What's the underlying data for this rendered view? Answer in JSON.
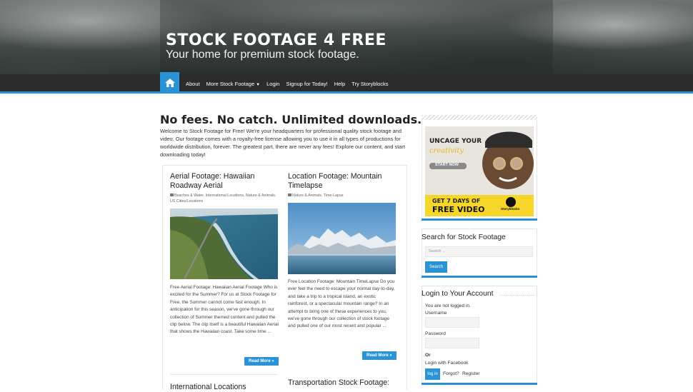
{
  "header": {
    "site_title": "STOCK FOOTAGE 4 FREE",
    "tagline": "Your home for premium stock footage."
  },
  "nav": {
    "home_icon": "home-icon",
    "items": [
      "About",
      "More Stock Footage",
      "Login",
      "Signup for Today!",
      "Help",
      "Try Storyblocks"
    ]
  },
  "intro": {
    "title": "No fees. No catch. Unlimited downloads.",
    "text": "Welcome to Stock Footage for Free! We're your headquarters for professional quality stock footage and video. Our footage comes with a royalty-free license allowing you to use it in all types of productions for worldwide distribution, forever. The greatest part, there are never any fees! Explore our content, and start downloading today!"
  },
  "posts": [
    {
      "title": "Aerial Footage: Hawaiian Roadway Aerial",
      "meta": "Beaches & Water, International Locations, Nature & Animals, US Cities/Locations",
      "excerpt": "Free Aerial Footage: Hawaiian Aerial Footage Who is excited for the Summer? For us at Stock Footage for Free, the Summer cannot come fast enough. In anticipation for this season, we've gone through our collection of Summer themed content and pulled the clip below. The clip itself is a beautiful Hawaiian Aerial that shows the Hawaiian coast. Take some time ...",
      "read_more": "Read More »"
    },
    {
      "title": "Location Footage: Mountain Timelapse",
      "meta": "Nature & Animals, Time-Lapse",
      "excerpt": "Free Location Footage: Mountain TimeLapse Do you ever feel the need to escape your normal day-to-day, and take a trip to a tropical island, an exotic rainforest, or a spectacular mountain range? In an attempt to bring one of these experiences to you, we've gone through our collection of stock footage and pulled one of our most recent and popular ...",
      "read_more": "Read More »"
    },
    {
      "title": "International Locations"
    },
    {
      "title": "Transportation Stock Footage:"
    }
  ],
  "sidebar": {
    "ad": {
      "headline": "UNCAGE YOUR",
      "script": "creativity",
      "cta": "START NOW",
      "offer_line1": "GET 7 DAYS OF",
      "offer_line2": "FREE VIDEO",
      "brand": "Storyblocks"
    },
    "search": {
      "title": "Search for Stock Footage",
      "placeholder": "Search ...",
      "button": "Search"
    },
    "login": {
      "title": "Login to Your Account",
      "status": "You are not logged in.",
      "username_label": "Username",
      "password_label": "Password",
      "or": "Or",
      "facebook": "Login with Facebook",
      "login_button": "log in",
      "forgot": "Forgot?",
      "register": "Register"
    }
  },
  "colors": {
    "accent": "#2a93d5",
    "nav_bg": "#2b2b2b",
    "ad_yellow": "#f6d629"
  }
}
